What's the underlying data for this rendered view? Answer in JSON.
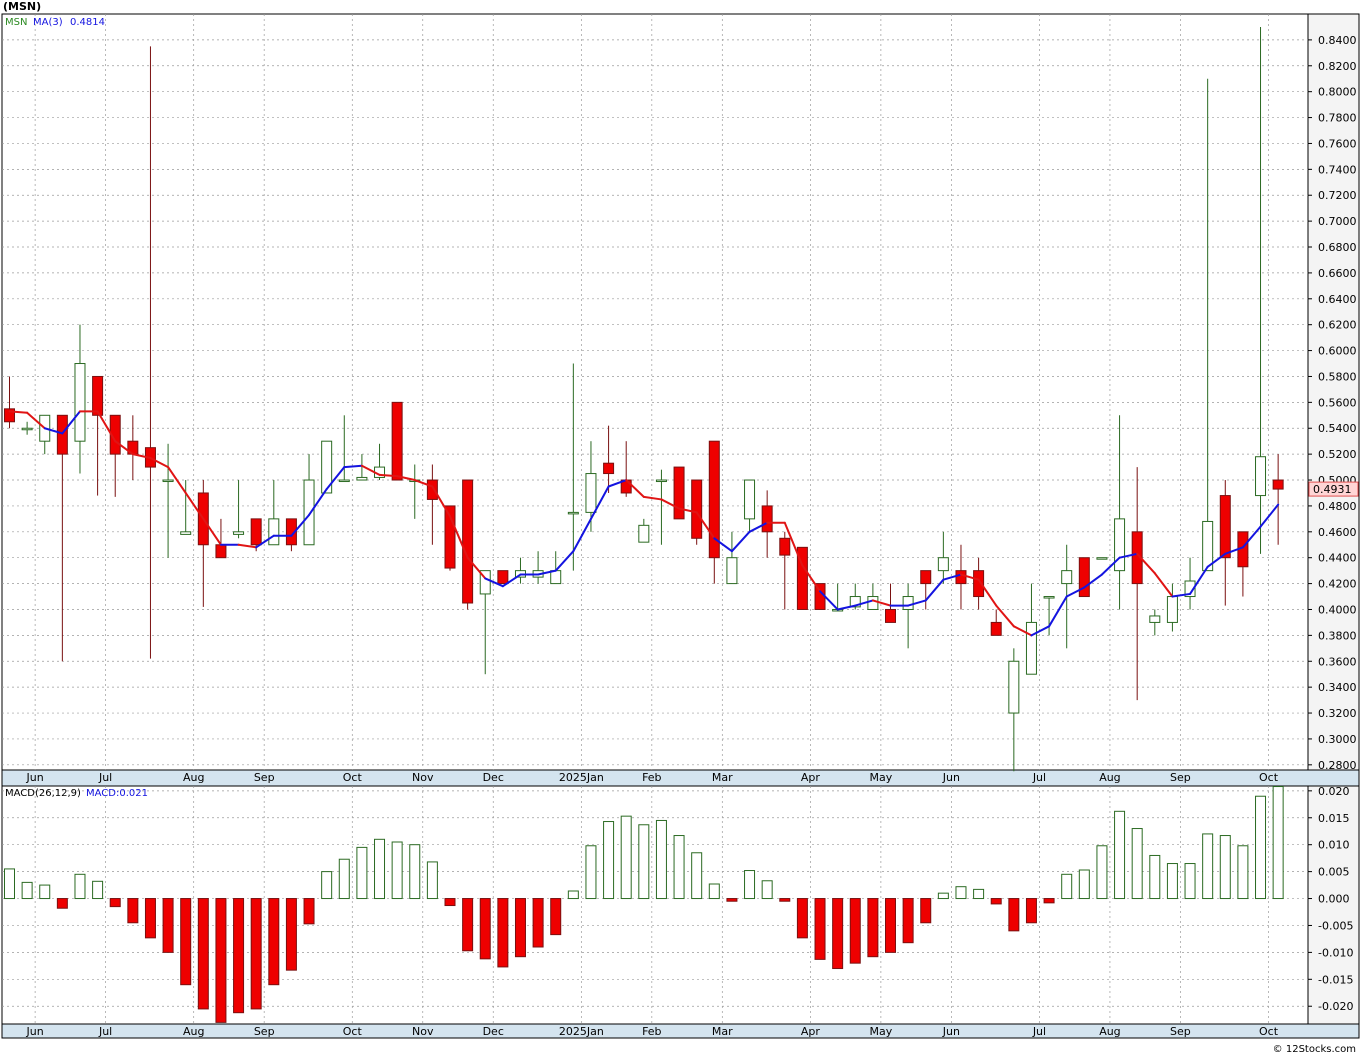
{
  "symbol_title": "(MSN)",
  "credit": "© 12Stocks.com",
  "chart_data": [
    {
      "type": "candlestick",
      "legend": {
        "symbol": "MSN",
        "ma_label": "MA(3)",
        "ma_value": "0.4814"
      },
      "last_price_label": "0.4931",
      "ylim": [
        0.276,
        0.86
      ],
      "y_ticks": [
        0.28,
        0.3,
        0.32,
        0.34,
        0.36,
        0.38,
        0.4,
        0.42,
        0.44,
        0.46,
        0.48,
        0.5,
        0.52,
        0.54,
        0.56,
        0.58,
        0.6,
        0.62,
        0.64,
        0.66,
        0.68,
        0.7,
        0.72,
        0.74,
        0.76,
        0.78,
        0.8,
        0.82,
        0.84
      ],
      "y_tick_labels": [
        "0.2800",
        "0.3000",
        "0.3200",
        "0.3400",
        "0.3600",
        "0.3800",
        "0.4000",
        "0.4200",
        "0.4400",
        "0.4600",
        "0.4800",
        "0.5000",
        "0.5200",
        "0.5400",
        "0.5600",
        "0.5800",
        "0.6000",
        "0.6200",
        "0.6400",
        "0.6600",
        "0.6800",
        "0.7000",
        "0.7200",
        "0.7400",
        "0.7600",
        "0.7800",
        "0.8000",
        "0.8200",
        "0.8400"
      ],
      "x_labels": [
        {
          "label": "Jun",
          "i": 1
        },
        {
          "label": "Jul",
          "i": 5
        },
        {
          "label": "Aug",
          "i": 10
        },
        {
          "label": "Sep",
          "i": 14
        },
        {
          "label": "Oct",
          "i": 19
        },
        {
          "label": "Nov",
          "i": 23
        },
        {
          "label": "Dec",
          "i": 27
        },
        {
          "label": "2025Jan",
          "i": 32
        },
        {
          "label": "Feb",
          "i": 36
        },
        {
          "label": "Mar",
          "i": 40
        },
        {
          "label": "Apr",
          "i": 45
        },
        {
          "label": "May",
          "i": 49
        },
        {
          "label": "Jun",
          "i": 53
        },
        {
          "label": "Jul",
          "i": 58
        },
        {
          "label": "Aug",
          "i": 62
        },
        {
          "label": "Sep",
          "i": 66
        },
        {
          "label": "Oct",
          "i": 71
        }
      ],
      "candles": [
        {
          "o": 0.555,
          "h": 0.58,
          "l": 0.54,
          "c": 0.545
        },
        {
          "o": 0.54,
          "h": 0.545,
          "l": 0.535,
          "c": 0.54
        },
        {
          "o": 0.53,
          "h": 0.55,
          "l": 0.52,
          "c": 0.55
        },
        {
          "o": 0.55,
          "h": 0.55,
          "l": 0.36,
          "c": 0.52
        },
        {
          "o": 0.53,
          "h": 0.62,
          "l": 0.505,
          "c": 0.59
        },
        {
          "o": 0.58,
          "h": 0.58,
          "l": 0.488,
          "c": 0.55
        },
        {
          "o": 0.55,
          "h": 0.55,
          "l": 0.487,
          "c": 0.52
        },
        {
          "o": 0.53,
          "h": 0.55,
          "l": 0.5,
          "c": 0.52
        },
        {
          "o": 0.525,
          "h": 0.835,
          "l": 0.362,
          "c": 0.51
        },
        {
          "o": 0.5,
          "h": 0.528,
          "l": 0.44,
          "c": 0.5
        },
        {
          "o": 0.458,
          "h": 0.5,
          "l": 0.46,
          "c": 0.46
        },
        {
          "o": 0.49,
          "h": 0.5,
          "l": 0.402,
          "c": 0.45
        },
        {
          "o": 0.45,
          "h": 0.47,
          "l": 0.44,
          "c": 0.44
        },
        {
          "o": 0.458,
          "h": 0.5,
          "l": 0.455,
          "c": 0.46
        },
        {
          "o": 0.47,
          "h": 0.47,
          "l": 0.445,
          "c": 0.45
        },
        {
          "o": 0.45,
          "h": 0.5,
          "l": 0.45,
          "c": 0.47
        },
        {
          "o": 0.47,
          "h": 0.47,
          "l": 0.445,
          "c": 0.45
        },
        {
          "o": 0.45,
          "h": 0.52,
          "l": 0.45,
          "c": 0.5
        },
        {
          "o": 0.49,
          "h": 0.53,
          "l": 0.49,
          "c": 0.53
        },
        {
          "o": 0.5,
          "h": 0.55,
          "l": 0.5,
          "c": 0.5
        },
        {
          "o": 0.5,
          "h": 0.52,
          "l": 0.5,
          "c": 0.502
        },
        {
          "o": 0.502,
          "h": 0.528,
          "l": 0.5,
          "c": 0.51
        },
        {
          "o": 0.56,
          "h": 0.56,
          "l": 0.5,
          "c": 0.5
        },
        {
          "o": 0.5,
          "h": 0.512,
          "l": 0.47,
          "c": 0.5
        },
        {
          "o": 0.5,
          "h": 0.512,
          "l": 0.45,
          "c": 0.485
        },
        {
          "o": 0.48,
          "h": 0.48,
          "l": 0.43,
          "c": 0.432
        },
        {
          "o": 0.5,
          "h": 0.5,
          "l": 0.4,
          "c": 0.405
        },
        {
          "o": 0.412,
          "h": 0.43,
          "l": 0.35,
          "c": 0.43
        },
        {
          "o": 0.43,
          "h": 0.43,
          "l": 0.42,
          "c": 0.42
        },
        {
          "o": 0.425,
          "h": 0.44,
          "l": 0.42,
          "c": 0.43
        },
        {
          "o": 0.425,
          "h": 0.445,
          "l": 0.42,
          "c": 0.43
        },
        {
          "o": 0.42,
          "h": 0.445,
          "l": 0.42,
          "c": 0.43
        },
        {
          "o": 0.475,
          "h": 0.59,
          "l": 0.43,
          "c": 0.475
        },
        {
          "o": 0.475,
          "h": 0.53,
          "l": 0.46,
          "c": 0.505
        },
        {
          "o": 0.513,
          "h": 0.542,
          "l": 0.49,
          "c": 0.505
        },
        {
          "o": 0.5,
          "h": 0.53,
          "l": 0.487,
          "c": 0.49
        },
        {
          "o": 0.452,
          "h": 0.47,
          "l": 0.452,
          "c": 0.465
        },
        {
          "o": 0.5,
          "h": 0.508,
          "l": 0.45,
          "c": 0.5
        },
        {
          "o": 0.51,
          "h": 0.51,
          "l": 0.47,
          "c": 0.47
        },
        {
          "o": 0.5,
          "h": 0.5,
          "l": 0.45,
          "c": 0.455
        },
        {
          "o": 0.53,
          "h": 0.53,
          "l": 0.42,
          "c": 0.44
        },
        {
          "o": 0.42,
          "h": 0.46,
          "l": 0.42,
          "c": 0.44
        },
        {
          "o": 0.47,
          "h": 0.5,
          "l": 0.46,
          "c": 0.5
        },
        {
          "o": 0.48,
          "h": 0.492,
          "l": 0.44,
          "c": 0.46
        },
        {
          "o": 0.455,
          "h": 0.46,
          "l": 0.4,
          "c": 0.442
        },
        {
          "o": 0.448,
          "h": 0.448,
          "l": 0.4,
          "c": 0.4
        },
        {
          "o": 0.42,
          "h": 0.42,
          "l": 0.4,
          "c": 0.4
        },
        {
          "o": 0.4,
          "h": 0.42,
          "l": 0.4,
          "c": 0.4
        },
        {
          "o": 0.402,
          "h": 0.42,
          "l": 0.4,
          "c": 0.41
        },
        {
          "o": 0.4,
          "h": 0.42,
          "l": 0.4,
          "c": 0.41
        },
        {
          "o": 0.4,
          "h": 0.42,
          "l": 0.39,
          "c": 0.39
        },
        {
          "o": 0.4,
          "h": 0.42,
          "l": 0.37,
          "c": 0.41
        },
        {
          "o": 0.43,
          "h": 0.43,
          "l": 0.4,
          "c": 0.42
        },
        {
          "o": 0.43,
          "h": 0.46,
          "l": 0.42,
          "c": 0.44
        },
        {
          "o": 0.43,
          "h": 0.45,
          "l": 0.4,
          "c": 0.42
        },
        {
          "o": 0.43,
          "h": 0.44,
          "l": 0.4,
          "c": 0.41
        },
        {
          "o": 0.39,
          "h": 0.4,
          "l": 0.38,
          "c": 0.38
        },
        {
          "o": 0.32,
          "h": 0.37,
          "l": 0.275,
          "c": 0.36
        },
        {
          "o": 0.35,
          "h": 0.42,
          "l": 0.35,
          "c": 0.39
        },
        {
          "o": 0.41,
          "h": 0.41,
          "l": 0.38,
          "c": 0.41
        },
        {
          "o": 0.42,
          "h": 0.45,
          "l": 0.37,
          "c": 0.43
        },
        {
          "o": 0.44,
          "h": 0.44,
          "l": 0.41,
          "c": 0.41
        },
        {
          "o": 0.44,
          "h": 0.44,
          "l": 0.44,
          "c": 0.44
        },
        {
          "o": 0.43,
          "h": 0.55,
          "l": 0.4,
          "c": 0.47
        },
        {
          "o": 0.46,
          "h": 0.51,
          "l": 0.33,
          "c": 0.42
        },
        {
          "o": 0.39,
          "h": 0.4,
          "l": 0.38,
          "c": 0.395
        },
        {
          "o": 0.39,
          "h": 0.42,
          "l": 0.383,
          "c": 0.41
        },
        {
          "o": 0.41,
          "h": 0.44,
          "l": 0.4,
          "c": 0.422
        },
        {
          "o": 0.43,
          "h": 0.81,
          "l": 0.43,
          "c": 0.468
        },
        {
          "o": 0.488,
          "h": 0.5,
          "l": 0.403,
          "c": 0.44
        },
        {
          "o": 0.46,
          "h": 0.46,
          "l": 0.41,
          "c": 0.433
        },
        {
          "o": 0.488,
          "h": 0.85,
          "l": 0.443,
          "c": 0.518
        },
        {
          "o": 0.5,
          "h": 0.52,
          "l": 0.45,
          "c": 0.493
        }
      ],
      "ma3": [
        0.553,
        0.552,
        0.54,
        0.536,
        0.553,
        0.553,
        0.53,
        0.52,
        0.517,
        0.51,
        0.49,
        0.47,
        0.45,
        0.45,
        0.448,
        0.457,
        0.457,
        0.473,
        0.493,
        0.51,
        0.511,
        0.504,
        0.503,
        0.5,
        0.495,
        0.472,
        0.44,
        0.424,
        0.418,
        0.427,
        0.427,
        0.43,
        0.445,
        0.47,
        0.495,
        0.5,
        0.487,
        0.485,
        0.478,
        0.475,
        0.455,
        0.445,
        0.46,
        0.467,
        0.467,
        0.434,
        0.414,
        0.4,
        0.403,
        0.407,
        0.403,
        0.403,
        0.407,
        0.423,
        0.427,
        0.423,
        0.403,
        0.387,
        0.38,
        0.387,
        0.41,
        0.417,
        0.427,
        0.44,
        0.443,
        0.428,
        0.41,
        0.412,
        0.433,
        0.443,
        0.448,
        0.464,
        0.481
      ],
      "ma3_up": [
        false,
        false,
        false,
        true,
        true,
        false,
        false,
        false,
        false,
        false,
        false,
        false,
        false,
        true,
        false,
        true,
        true,
        true,
        true,
        true,
        true,
        false,
        false,
        false,
        false,
        false,
        false,
        false,
        true,
        true,
        true,
        true,
        true,
        true,
        true,
        true,
        false,
        false,
        false,
        false,
        false,
        true,
        true,
        true,
        false,
        false,
        false,
        true,
        true,
        true,
        false,
        true,
        true,
        true,
        true,
        false,
        false,
        false,
        false,
        true,
        true,
        true,
        true,
        true,
        true,
        false,
        false,
        true,
        true,
        true,
        true,
        true,
        true
      ]
    },
    {
      "type": "bar",
      "legend": {
        "label": "MACD(26,12,9)",
        "value_label": "MACD:0.021"
      },
      "ylim": [
        -0.0233,
        0.0209
      ],
      "y_ticks": [
        -0.02,
        -0.015,
        -0.01,
        -0.005,
        0.0,
        0.005,
        0.01,
        0.015,
        0.02
      ],
      "y_tick_labels": [
        "-0.020",
        "-0.015",
        "-0.010",
        "-0.005",
        "0.000",
        "0.005",
        "0.010",
        "0.015",
        "0.020"
      ],
      "x_labels": [
        {
          "label": "Jun",
          "i": 1
        },
        {
          "label": "Jul",
          "i": 5
        },
        {
          "label": "Aug",
          "i": 10
        },
        {
          "label": "Sep",
          "i": 14
        },
        {
          "label": "Oct",
          "i": 19
        },
        {
          "label": "Nov",
          "i": 23
        },
        {
          "label": "Dec",
          "i": 27
        },
        {
          "label": "2025Jan",
          "i": 32
        },
        {
          "label": "Feb",
          "i": 36
        },
        {
          "label": "Mar",
          "i": 40
        },
        {
          "label": "Apr",
          "i": 45
        },
        {
          "label": "May",
          "i": 49
        },
        {
          "label": "Jun",
          "i": 53
        },
        {
          "label": "Jul",
          "i": 58
        },
        {
          "label": "Aug",
          "i": 62
        },
        {
          "label": "Sep",
          "i": 66
        },
        {
          "label": "Oct",
          "i": 71
        }
      ],
      "values": [
        0.0055,
        0.003,
        0.0025,
        -0.0018,
        0.0045,
        0.0032,
        -0.0015,
        -0.0045,
        -0.0073,
        -0.01,
        -0.016,
        -0.0205,
        -0.023,
        -0.0212,
        -0.0205,
        -0.016,
        -0.0133,
        -0.0047,
        0.005,
        0.0073,
        0.0095,
        0.011,
        0.0105,
        0.01,
        0.0068,
        -0.0013,
        -0.0097,
        -0.0112,
        -0.0127,
        -0.0108,
        -0.009,
        -0.0067,
        0.0014,
        0.0098,
        0.0143,
        0.0153,
        0.0137,
        0.0145,
        0.0117,
        0.0085,
        0.0027,
        -0.0005,
        0.0052,
        0.0033,
        -0.0005,
        -0.0073,
        -0.0113,
        -0.013,
        -0.012,
        -0.0108,
        -0.01,
        -0.0082,
        -0.0045,
        0.001,
        0.0022,
        0.0017,
        -0.001,
        -0.006,
        -0.0045,
        -0.0008,
        0.0045,
        0.0053,
        0.0098,
        0.0162,
        0.013,
        0.008,
        0.0065,
        0.0065,
        0.012,
        0.0117,
        0.0098,
        0.019,
        0.0208
      ]
    }
  ]
}
